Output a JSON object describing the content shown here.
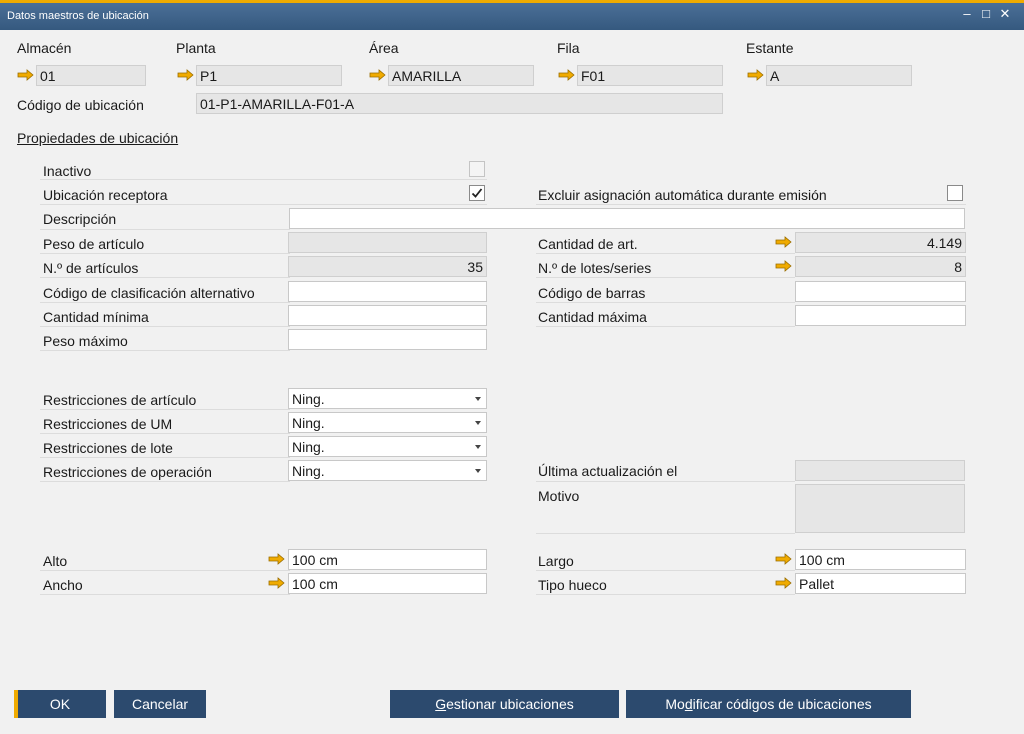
{
  "window": {
    "title": "Datos maestros de ubicación"
  },
  "header": {
    "almacen": {
      "label": "Almacén",
      "value": "01"
    },
    "planta": {
      "label": "Planta",
      "value": "P1"
    },
    "area": {
      "label": "Área",
      "value": "AMARILLA"
    },
    "fila": {
      "label": "Fila",
      "value": "F01"
    },
    "estante": {
      "label": "Estante",
      "value": "A"
    },
    "codigo": {
      "label": "Código de ubicación",
      "value": "01-P1-AMARILLA-F01-A"
    }
  },
  "section": {
    "title": "Propiedades de ubicación"
  },
  "props": {
    "inactivo": {
      "label": "Inactivo",
      "checked": false
    },
    "receptora": {
      "label": "Ubicación receptora",
      "checked": true
    },
    "excluir": {
      "label": "Excluir asignación automática durante emisión",
      "checked": false
    },
    "descripcion": {
      "label": "Descripción",
      "value": ""
    },
    "peso_articulo": {
      "label": "Peso de artículo",
      "value": ""
    },
    "num_articulos": {
      "label": "N.º de artículos",
      "value": "35"
    },
    "cod_clasif": {
      "label": "Código de clasificación alternativo",
      "value": ""
    },
    "cant_minima": {
      "label": "Cantidad mínima",
      "value": ""
    },
    "peso_maximo": {
      "label": "Peso máximo",
      "value": ""
    },
    "cantidad_art": {
      "label": "Cantidad de art.",
      "value": "4.149"
    },
    "num_lotes": {
      "label": "N.º de lotes/series",
      "value": "8"
    },
    "cod_barras": {
      "label": "Código de barras",
      "value": ""
    },
    "cant_maxima": {
      "label": "Cantidad máxima",
      "value": ""
    }
  },
  "restrictions": {
    "articulo": {
      "label": "Restricciones de artículo",
      "value": "Ning."
    },
    "um": {
      "label": "Restricciones de UM",
      "value": "Ning."
    },
    "lote": {
      "label": "Restricciones de lote",
      "value": "Ning."
    },
    "operacion": {
      "label": "Restricciones de operación",
      "value": "Ning."
    },
    "ultima": {
      "label": "Última actualización el",
      "value": ""
    },
    "motivo": {
      "label": "Motivo",
      "value": ""
    }
  },
  "dimensions": {
    "alto": {
      "label": "Alto",
      "value": "100 cm"
    },
    "ancho": {
      "label": "Ancho",
      "value": "100 cm"
    },
    "largo": {
      "label": "Largo",
      "value": "100 cm"
    },
    "tipo_hueco": {
      "label": "Tipo hueco",
      "value": "Pallet"
    }
  },
  "buttons": {
    "ok": "OK",
    "cancelar": "Cancelar",
    "gestionar_first": "G",
    "gestionar_rest": "estionar ubicaciones",
    "modificar_first": "Mo",
    "modificar_u": "d",
    "modificar_rest": "ificar códigos de ubicaciones"
  },
  "colors": {
    "accent": "#f0ab00",
    "button": "#2c4a6e",
    "titlebar": "#3f6389"
  }
}
